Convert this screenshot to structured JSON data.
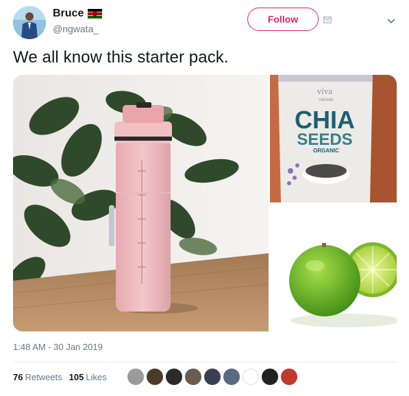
{
  "user": {
    "name": "Bruce",
    "handle": "@ngwata_",
    "follow_label": "Follow"
  },
  "tweet": {
    "text": "We all know this starter pack."
  },
  "media": {
    "images": [
      {
        "name": "pink water bottle photo"
      },
      {
        "name": "chia seeds bag photo",
        "brand_text": "viva",
        "brand_sub": "naturals",
        "title_1": "CHIA",
        "title_2": "SEEDS",
        "sub": "ORGANIC"
      },
      {
        "name": "limes photo"
      }
    ]
  },
  "meta": {
    "timestamp": "1:48 AM - 30 Jan 2019",
    "retweets_count": "76",
    "retweets_label": "Retweets",
    "likes_count": "105",
    "likes_label": "Likes"
  },
  "colors": {
    "follow_accent": "#e0245e",
    "muted": "#657786",
    "text": "#14171a"
  },
  "icons": [
    "kenya-flag-icon",
    "direct-message-icon",
    "chevron-down-icon"
  ]
}
